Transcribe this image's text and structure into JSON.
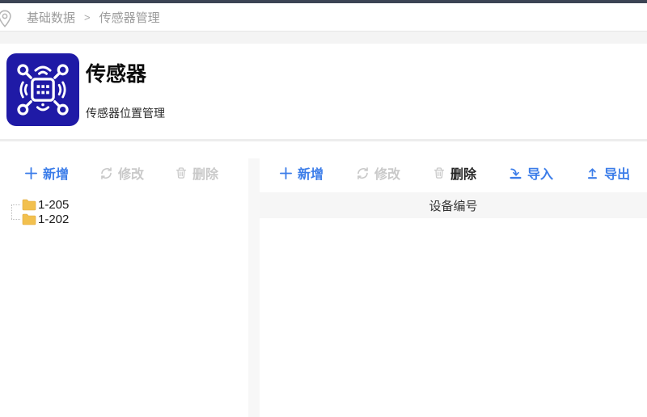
{
  "colors": {
    "topbar": "#3c4454",
    "accent": "#3c7de9",
    "disabled": "#c9c9c9",
    "icon_bg": "#1f1aa6",
    "folder": "#f2c04e",
    "breadcrumb_text": "#9b9b9b"
  },
  "breadcrumb": {
    "separator": ">",
    "items": [
      {
        "label": "基础数据"
      },
      {
        "label": "传感器管理"
      }
    ]
  },
  "header": {
    "title": "传感器",
    "subtitle": "传感器位置管理",
    "icon": "sensor-icon"
  },
  "left_panel": {
    "toolbar": [
      {
        "label": "新增",
        "icon": "plus-icon",
        "state": "enabled"
      },
      {
        "label": "修改",
        "icon": "refresh-icon",
        "state": "disabled"
      },
      {
        "label": "删除",
        "icon": "trash-icon",
        "state": "disabled"
      }
    ],
    "tree": [
      {
        "label": "1-205",
        "icon": "folder-icon"
      },
      {
        "label": "1-202",
        "icon": "folder-icon"
      }
    ]
  },
  "right_panel": {
    "toolbar": [
      {
        "label": "新增",
        "icon": "plus-icon",
        "state": "enabled"
      },
      {
        "label": "修改",
        "icon": "refresh-icon",
        "state": "disabled"
      },
      {
        "label": "删除",
        "icon": "trash-icon",
        "state": "mixed"
      },
      {
        "label": "导入",
        "icon": "import-icon",
        "state": "enabled"
      },
      {
        "label": "导出",
        "icon": "export-icon",
        "state": "enabled"
      }
    ],
    "table": {
      "columns": [
        {
          "label": "设备编号"
        }
      ],
      "rows": []
    }
  }
}
